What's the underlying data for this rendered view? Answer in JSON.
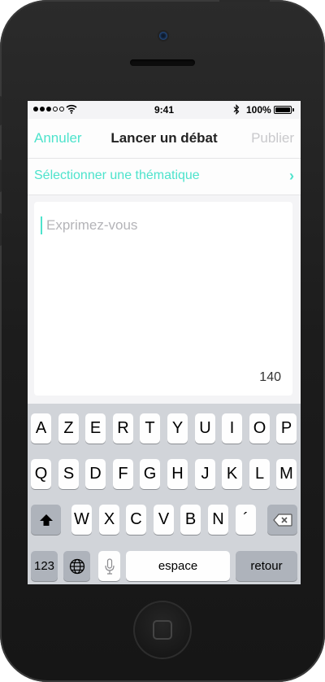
{
  "status_bar": {
    "time": "9:41",
    "battery_percent": "100%",
    "battery_level": 1.0
  },
  "nav": {
    "cancel_label": "Annuler",
    "title": "Lancer un débat",
    "publish_label": "Publier"
  },
  "theme_row": {
    "label": "Sélectionner une thématique",
    "chevron": "›"
  },
  "composer": {
    "placeholder": "Exprimez-vous",
    "counter": "140"
  },
  "keyboard": {
    "row1": [
      "A",
      "Z",
      "E",
      "R",
      "T",
      "Y",
      "U",
      "I",
      "O",
      "P"
    ],
    "row2": [
      "Q",
      "S",
      "D",
      "F",
      "G",
      "H",
      "J",
      "K",
      "L",
      "M"
    ],
    "row3": [
      "W",
      "X",
      "C",
      "V",
      "B",
      "N",
      "´"
    ],
    "numbers_label": "123",
    "space_label": "espace",
    "return_label": "retour"
  },
  "colors": {
    "accent": "#4de3cc",
    "disabled": "#c9c9cc",
    "keyboard_bg": "#d1d4d9"
  },
  "icons": [
    "wifi-icon",
    "bluetooth-icon",
    "battery-icon",
    "shift-icon",
    "backspace-icon",
    "globe-icon",
    "microphone-icon",
    "chevron-right-icon"
  ]
}
